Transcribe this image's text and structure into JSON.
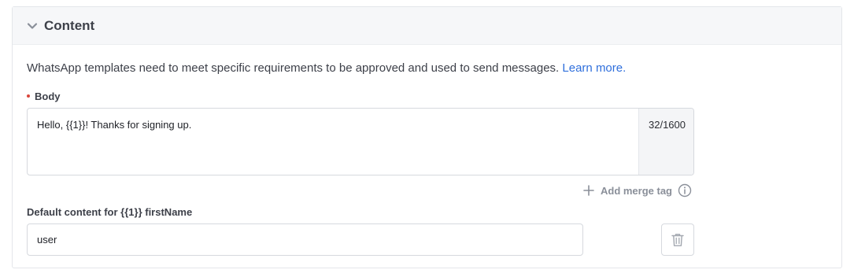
{
  "section": {
    "title": "Content",
    "expanded": true
  },
  "intro": {
    "text": "WhatsApp templates need to meet specific requirements to be approved and used to send messages.",
    "link_label": "Learn more."
  },
  "body": {
    "label": "Body",
    "required": true,
    "value": "Hello, {{1}}! Thanks for signing up.",
    "counter": "32/1600"
  },
  "merge_tag": {
    "label": "Add merge tag"
  },
  "default_content": {
    "label": "Default content for {{1}} firstName",
    "value": "user"
  },
  "icons": {
    "collapse": "chevron-down-icon",
    "add": "plus-icon",
    "info": "info-icon",
    "delete": "trash-icon"
  },
  "colors": {
    "link": "#2f6fdc",
    "required": "#d9453b",
    "muted": "#8a8f99"
  }
}
